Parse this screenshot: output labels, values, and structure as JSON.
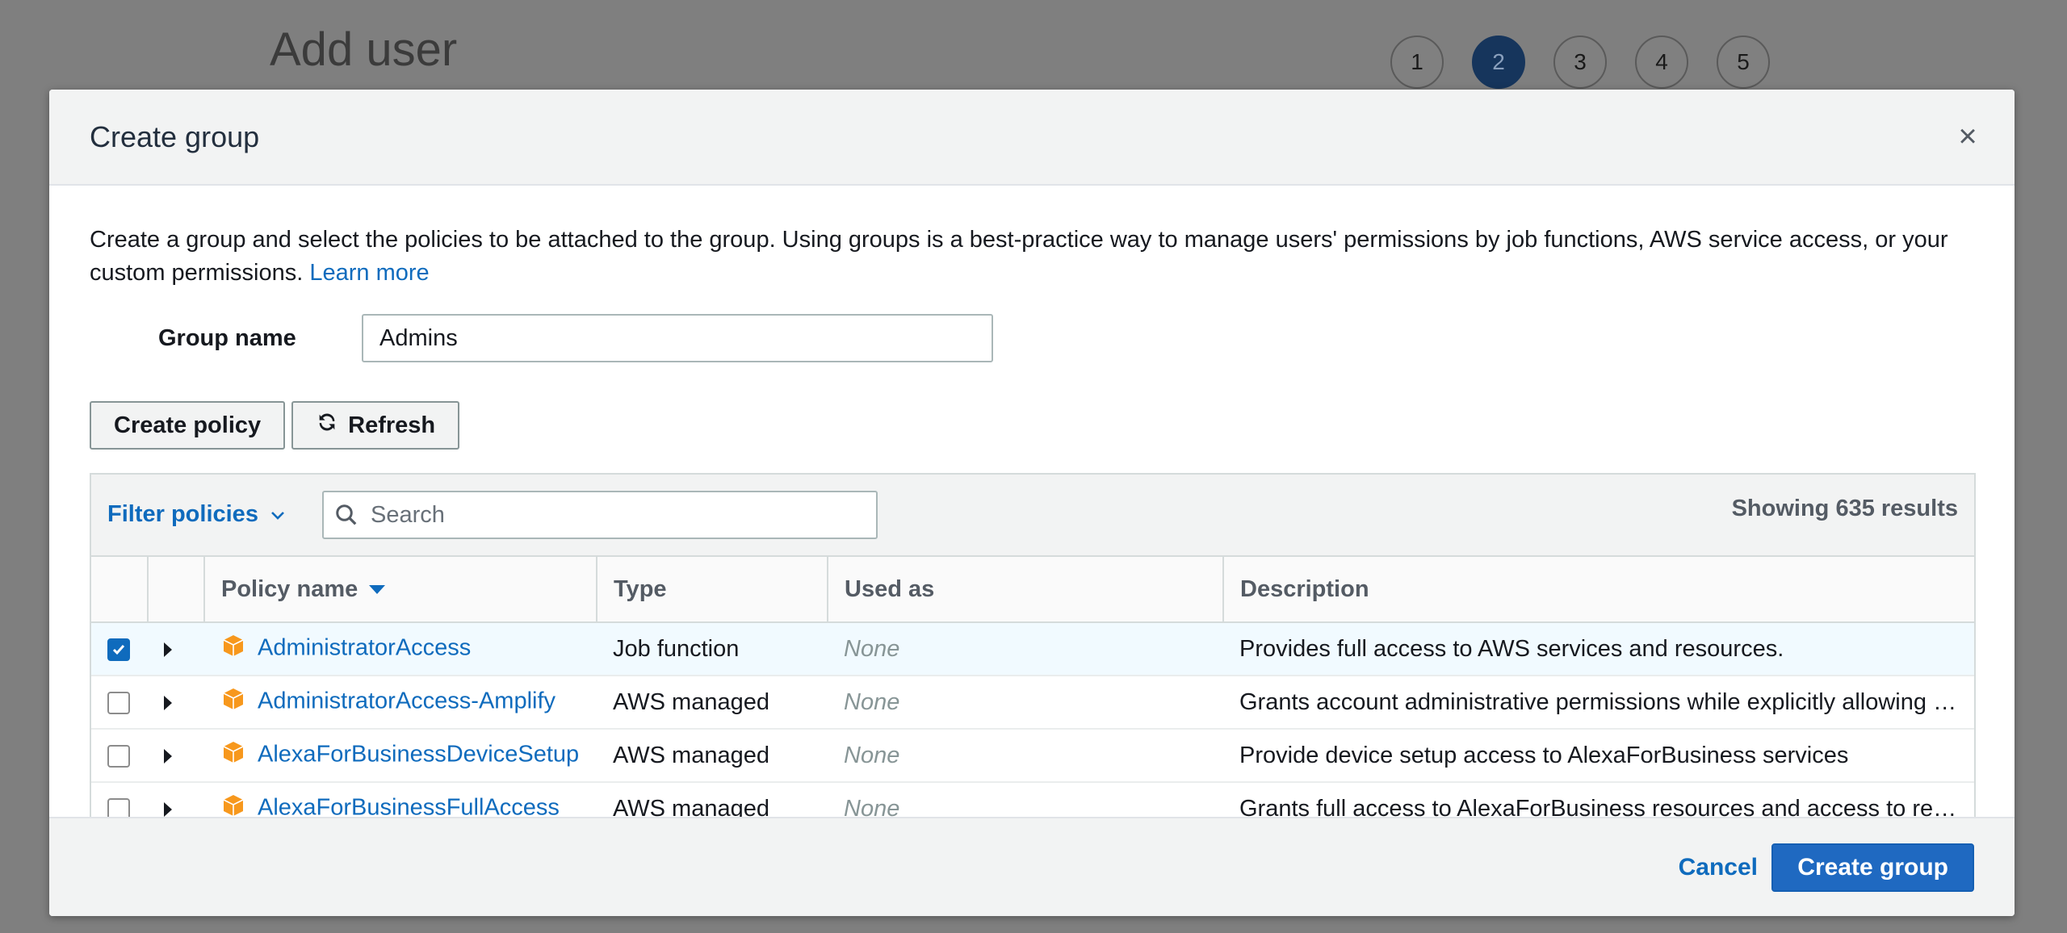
{
  "background": {
    "title": "Add user",
    "steps": [
      "1",
      "2",
      "3",
      "4",
      "5"
    ],
    "active_step": "2"
  },
  "modal": {
    "title": "Create group",
    "close_icon": "close-icon",
    "intro_text": "Create a group and select the policies to be attached to the group. Using groups is a best-practice way to manage users' permissions by job functions, AWS service access, or your custom permissions.",
    "learn_more": "Learn more",
    "group_name_label": "Group name",
    "group_name_value": "Admins",
    "create_policy_label": "Create policy",
    "refresh_label": "Refresh",
    "filter_label": "Filter policies",
    "search_placeholder": "Search",
    "results_text": "Showing 635 results",
    "columns": {
      "policy_name": "Policy name",
      "type": "Type",
      "used_as": "Used as",
      "description": "Description"
    },
    "rows": [
      {
        "checked": true,
        "name": "AdministratorAccess",
        "type": "Job function",
        "used_as": "None",
        "description": "Provides full access to AWS services and resources."
      },
      {
        "checked": false,
        "name": "AdministratorAccess-Amplify",
        "type": "AWS managed",
        "used_as": "None",
        "description": "Grants account administrative permissions while explicitly allowing dir…"
      },
      {
        "checked": false,
        "name": "AlexaForBusinessDeviceSetup",
        "type": "AWS managed",
        "used_as": "None",
        "description": "Provide device setup access to AlexaForBusiness services"
      },
      {
        "checked": false,
        "name": "AlexaForBusinessFullAccess",
        "type": "AWS managed",
        "used_as": "None",
        "description": "Grants full access to AlexaForBusiness resources and access to relate…"
      }
    ],
    "cancel_label": "Cancel",
    "create_group_label": "Create group"
  },
  "colors": {
    "accent": "#0f6bbd",
    "primary_button": "#1f69c1",
    "policy_icon": "#f7981d",
    "active_step": "#16355c"
  }
}
